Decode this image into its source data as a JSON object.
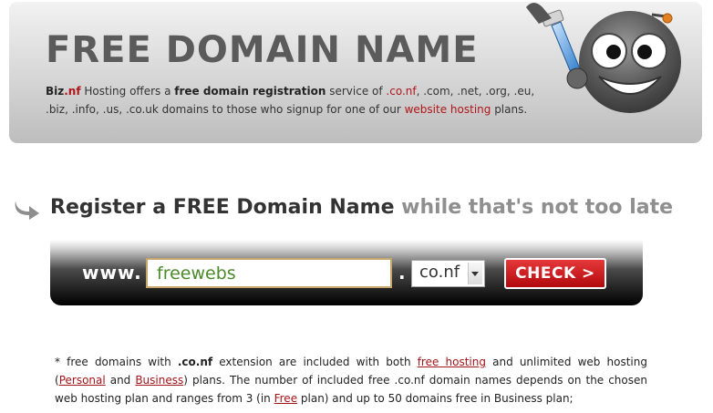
{
  "banner": {
    "title": "FREE DOMAIN NAME",
    "brand_name": "Biz",
    "brand_tld": ".nf",
    "desc_part1": " Hosting offers a ",
    "desc_bold": "free domain registration",
    "desc_part2": " service of ",
    "desc_conf": ".co.nf",
    "desc_part3": ", .com, .net, .org, .eu, .biz, .info, .us, .co.uk domains to those who signup for one of our ",
    "website_hosting_link": "website hosting",
    "desc_part4": " plans."
  },
  "register": {
    "heading_main": "Register a FREE Domain Name",
    "heading_muted": " while that's not too late"
  },
  "domain_search": {
    "prefix": "www.",
    "input_value": "freewebs",
    "separator": ".",
    "tld_selected": "co.nf",
    "check_label": "CHECK >"
  },
  "footnote": {
    "text1": "* free domains with ",
    "conf": ".co.nf",
    "text2": " extension are included with both ",
    "free_hosting_link": "free hosting",
    "text3": " and unlimited web hosting (",
    "personal_link": "Personal",
    "text4": " and ",
    "business_link": "Business",
    "text5": ") plans. The number of included free .co.nf domain names depends on the chosen web hosting plan and ranges from 3 (in ",
    "free_link": "Free",
    "text6": " plan) and up to 50 domains free in Business plan;"
  },
  "colors": {
    "accent_red": "#b0151a",
    "input_text_green": "#4a8a2a",
    "banner_title_gray": "#5b5b5b"
  },
  "icons": {
    "mascot": "smiley-painter-icon",
    "arrow": "curved-arrow-icon",
    "select": "chevron-down-icon"
  }
}
